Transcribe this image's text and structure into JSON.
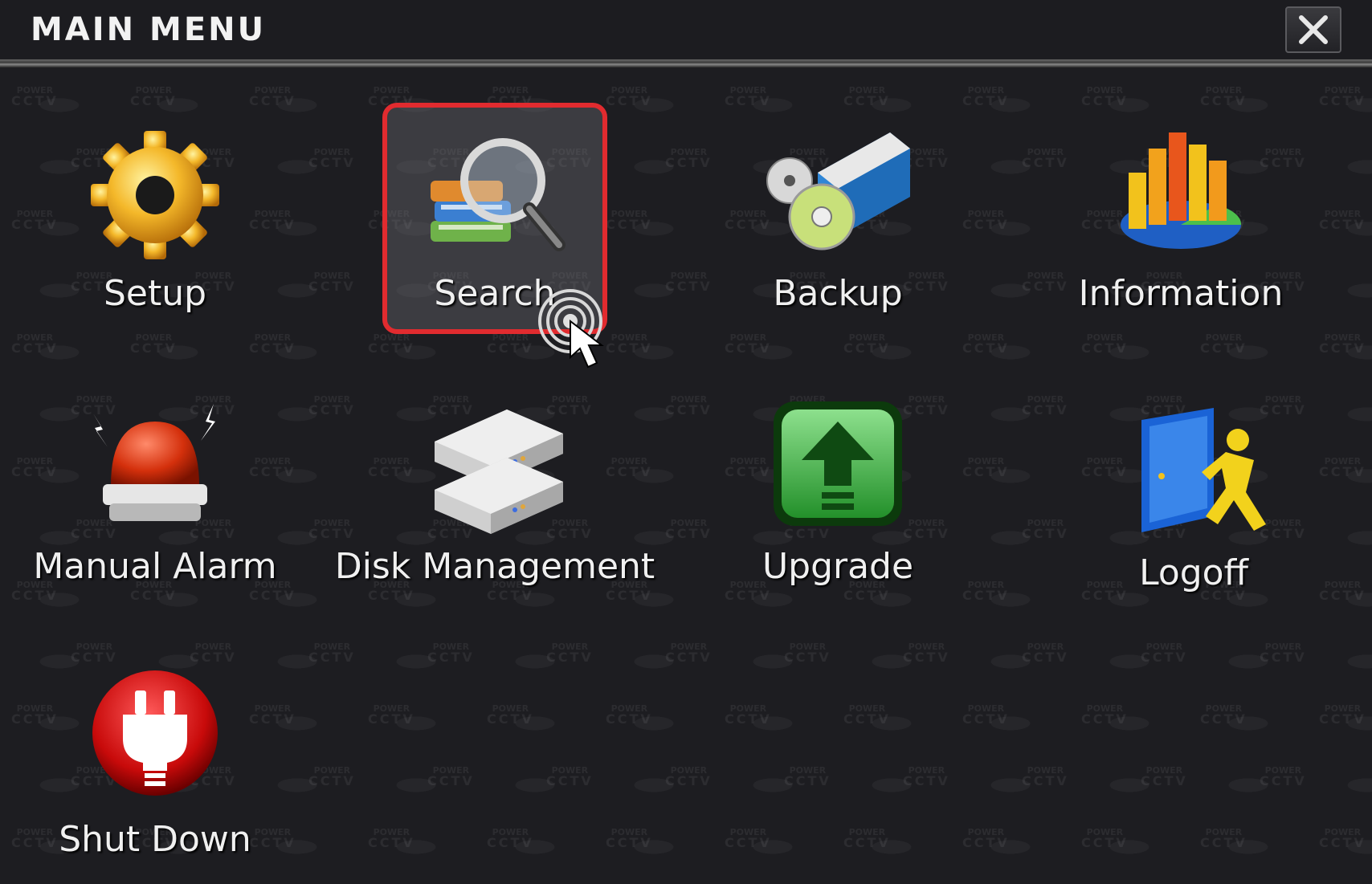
{
  "window": {
    "title": "MAIN MENU",
    "close_icon": "close-icon"
  },
  "watermark": {
    "line1": "POWER",
    "line2": "CCTV"
  },
  "menu": {
    "selected": "Search",
    "items": [
      {
        "label": "Setup",
        "icon": "gear-icon"
      },
      {
        "label": "Search",
        "icon": "magnifier-books-icon"
      },
      {
        "label": "Backup",
        "icon": "disc-drive-icon"
      },
      {
        "label": "Information",
        "icon": "bar-chart-icon"
      },
      {
        "label": "Manual Alarm",
        "icon": "alarm-siren-icon"
      },
      {
        "label": "Disk Management",
        "icon": "hard-disk-icon"
      },
      {
        "label": "Upgrade",
        "icon": "upload-arrow-icon"
      },
      {
        "label": "Logoff",
        "icon": "door-exit-icon"
      },
      {
        "label": "Shut Down",
        "icon": "power-plug-icon"
      }
    ]
  },
  "colors": {
    "background": "#1d1d21",
    "selection_border": "#e12b2f",
    "text": "#f0f0f0"
  }
}
